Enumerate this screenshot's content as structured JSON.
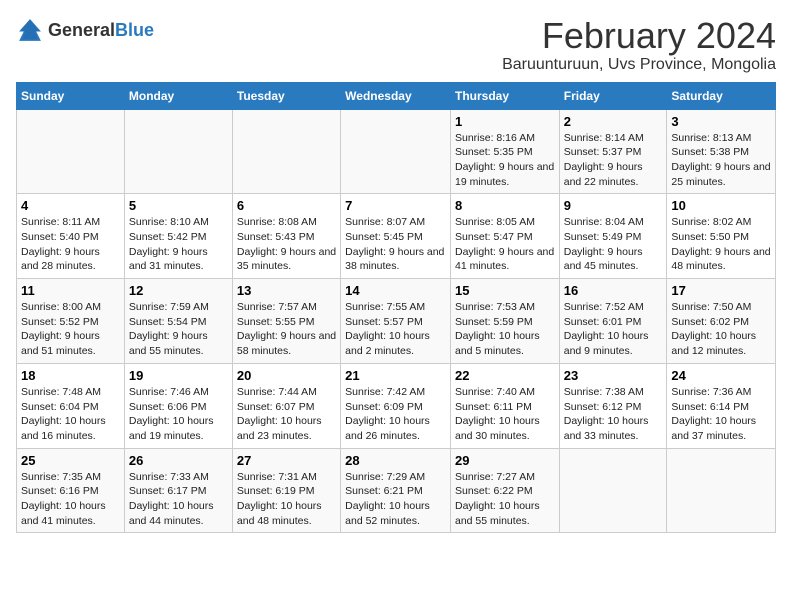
{
  "app": {
    "logo_general": "General",
    "logo_blue": "Blue"
  },
  "calendar": {
    "title": "February 2024",
    "subtitle": "Baruunturuun, Uvs Province, Mongolia",
    "days_of_week": [
      "Sunday",
      "Monday",
      "Tuesday",
      "Wednesday",
      "Thursday",
      "Friday",
      "Saturday"
    ],
    "weeks": [
      [
        {
          "day": "",
          "sunrise": "",
          "sunset": "",
          "daylight": ""
        },
        {
          "day": "",
          "sunrise": "",
          "sunset": "",
          "daylight": ""
        },
        {
          "day": "",
          "sunrise": "",
          "sunset": "",
          "daylight": ""
        },
        {
          "day": "",
          "sunrise": "",
          "sunset": "",
          "daylight": ""
        },
        {
          "day": "1",
          "sunrise": "Sunrise: 8:16 AM",
          "sunset": "Sunset: 5:35 PM",
          "daylight": "Daylight: 9 hours and 19 minutes."
        },
        {
          "day": "2",
          "sunrise": "Sunrise: 8:14 AM",
          "sunset": "Sunset: 5:37 PM",
          "daylight": "Daylight: 9 hours and 22 minutes."
        },
        {
          "day": "3",
          "sunrise": "Sunrise: 8:13 AM",
          "sunset": "Sunset: 5:38 PM",
          "daylight": "Daylight: 9 hours and 25 minutes."
        }
      ],
      [
        {
          "day": "4",
          "sunrise": "Sunrise: 8:11 AM",
          "sunset": "Sunset: 5:40 PM",
          "daylight": "Daylight: 9 hours and 28 minutes."
        },
        {
          "day": "5",
          "sunrise": "Sunrise: 8:10 AM",
          "sunset": "Sunset: 5:42 PM",
          "daylight": "Daylight: 9 hours and 31 minutes."
        },
        {
          "day": "6",
          "sunrise": "Sunrise: 8:08 AM",
          "sunset": "Sunset: 5:43 PM",
          "daylight": "Daylight: 9 hours and 35 minutes."
        },
        {
          "day": "7",
          "sunrise": "Sunrise: 8:07 AM",
          "sunset": "Sunset: 5:45 PM",
          "daylight": "Daylight: 9 hours and 38 minutes."
        },
        {
          "day": "8",
          "sunrise": "Sunrise: 8:05 AM",
          "sunset": "Sunset: 5:47 PM",
          "daylight": "Daylight: 9 hours and 41 minutes."
        },
        {
          "day": "9",
          "sunrise": "Sunrise: 8:04 AM",
          "sunset": "Sunset: 5:49 PM",
          "daylight": "Daylight: 9 hours and 45 minutes."
        },
        {
          "day": "10",
          "sunrise": "Sunrise: 8:02 AM",
          "sunset": "Sunset: 5:50 PM",
          "daylight": "Daylight: 9 hours and 48 minutes."
        }
      ],
      [
        {
          "day": "11",
          "sunrise": "Sunrise: 8:00 AM",
          "sunset": "Sunset: 5:52 PM",
          "daylight": "Daylight: 9 hours and 51 minutes."
        },
        {
          "day": "12",
          "sunrise": "Sunrise: 7:59 AM",
          "sunset": "Sunset: 5:54 PM",
          "daylight": "Daylight: 9 hours and 55 minutes."
        },
        {
          "day": "13",
          "sunrise": "Sunrise: 7:57 AM",
          "sunset": "Sunset: 5:55 PM",
          "daylight": "Daylight: 9 hours and 58 minutes."
        },
        {
          "day": "14",
          "sunrise": "Sunrise: 7:55 AM",
          "sunset": "Sunset: 5:57 PM",
          "daylight": "Daylight: 10 hours and 2 minutes."
        },
        {
          "day": "15",
          "sunrise": "Sunrise: 7:53 AM",
          "sunset": "Sunset: 5:59 PM",
          "daylight": "Daylight: 10 hours and 5 minutes."
        },
        {
          "day": "16",
          "sunrise": "Sunrise: 7:52 AM",
          "sunset": "Sunset: 6:01 PM",
          "daylight": "Daylight: 10 hours and 9 minutes."
        },
        {
          "day": "17",
          "sunrise": "Sunrise: 7:50 AM",
          "sunset": "Sunset: 6:02 PM",
          "daylight": "Daylight: 10 hours and 12 minutes."
        }
      ],
      [
        {
          "day": "18",
          "sunrise": "Sunrise: 7:48 AM",
          "sunset": "Sunset: 6:04 PM",
          "daylight": "Daylight: 10 hours and 16 minutes."
        },
        {
          "day": "19",
          "sunrise": "Sunrise: 7:46 AM",
          "sunset": "Sunset: 6:06 PM",
          "daylight": "Daylight: 10 hours and 19 minutes."
        },
        {
          "day": "20",
          "sunrise": "Sunrise: 7:44 AM",
          "sunset": "Sunset: 6:07 PM",
          "daylight": "Daylight: 10 hours and 23 minutes."
        },
        {
          "day": "21",
          "sunrise": "Sunrise: 7:42 AM",
          "sunset": "Sunset: 6:09 PM",
          "daylight": "Daylight: 10 hours and 26 minutes."
        },
        {
          "day": "22",
          "sunrise": "Sunrise: 7:40 AM",
          "sunset": "Sunset: 6:11 PM",
          "daylight": "Daylight: 10 hours and 30 minutes."
        },
        {
          "day": "23",
          "sunrise": "Sunrise: 7:38 AM",
          "sunset": "Sunset: 6:12 PM",
          "daylight": "Daylight: 10 hours and 33 minutes."
        },
        {
          "day": "24",
          "sunrise": "Sunrise: 7:36 AM",
          "sunset": "Sunset: 6:14 PM",
          "daylight": "Daylight: 10 hours and 37 minutes."
        }
      ],
      [
        {
          "day": "25",
          "sunrise": "Sunrise: 7:35 AM",
          "sunset": "Sunset: 6:16 PM",
          "daylight": "Daylight: 10 hours and 41 minutes."
        },
        {
          "day": "26",
          "sunrise": "Sunrise: 7:33 AM",
          "sunset": "Sunset: 6:17 PM",
          "daylight": "Daylight: 10 hours and 44 minutes."
        },
        {
          "day": "27",
          "sunrise": "Sunrise: 7:31 AM",
          "sunset": "Sunset: 6:19 PM",
          "daylight": "Daylight: 10 hours and 48 minutes."
        },
        {
          "day": "28",
          "sunrise": "Sunrise: 7:29 AM",
          "sunset": "Sunset: 6:21 PM",
          "daylight": "Daylight: 10 hours and 52 minutes."
        },
        {
          "day": "29",
          "sunrise": "Sunrise: 7:27 AM",
          "sunset": "Sunset: 6:22 PM",
          "daylight": "Daylight: 10 hours and 55 minutes."
        },
        {
          "day": "",
          "sunrise": "",
          "sunset": "",
          "daylight": ""
        },
        {
          "day": "",
          "sunrise": "",
          "sunset": "",
          "daylight": ""
        }
      ]
    ]
  }
}
